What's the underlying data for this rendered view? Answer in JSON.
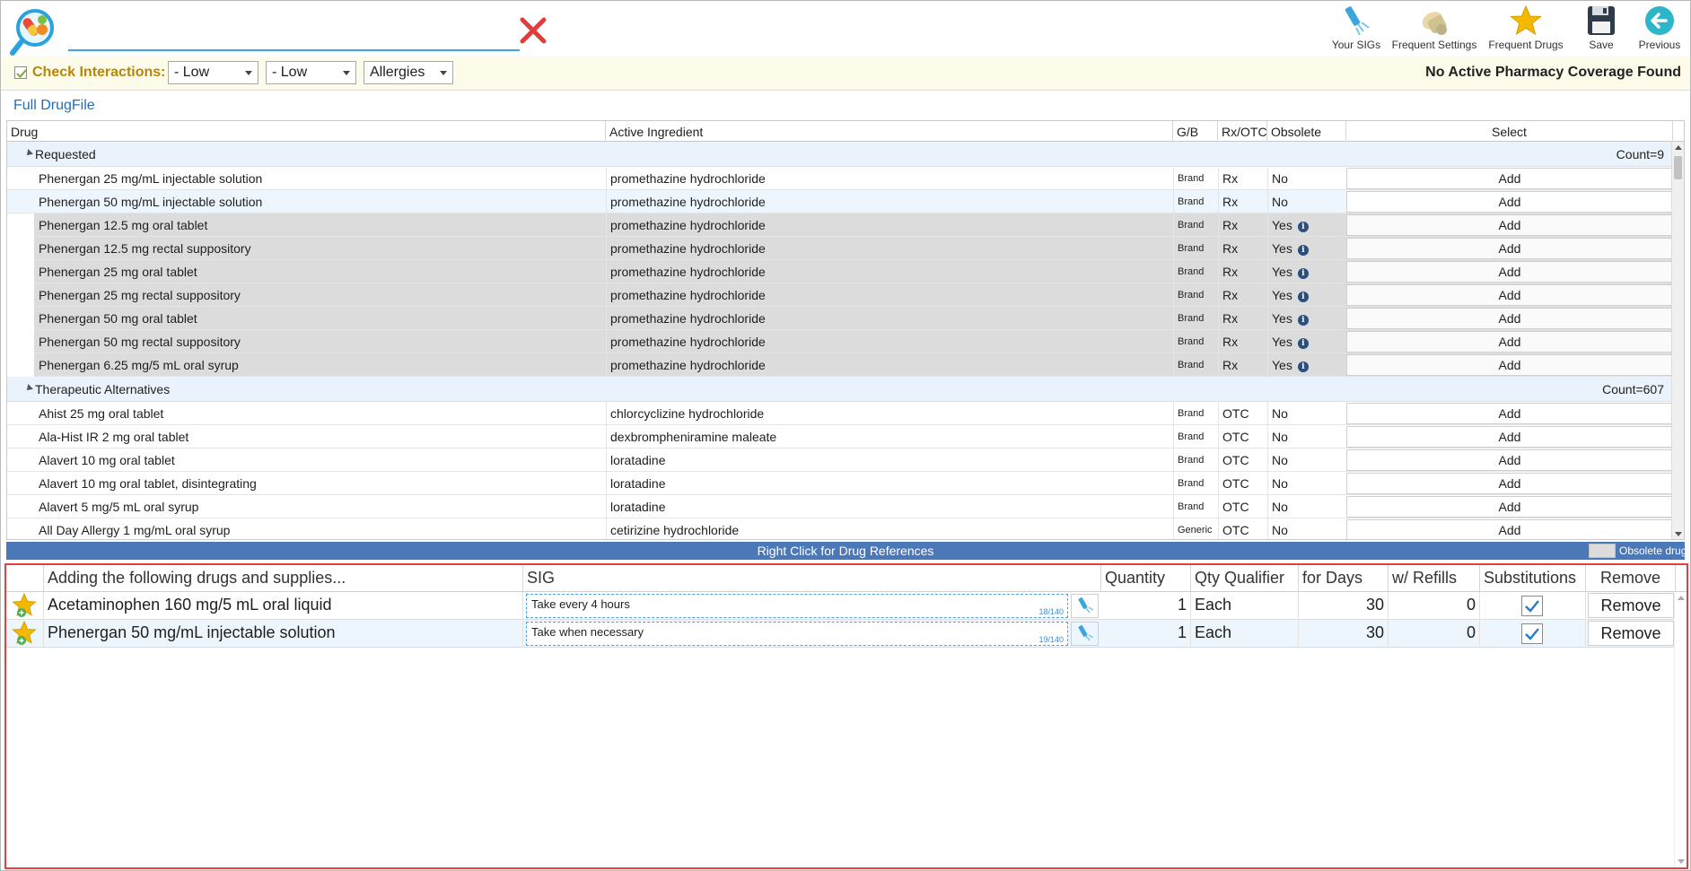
{
  "search": {
    "value": "",
    "placeholder": ""
  },
  "toolbar": {
    "your_sigs": "Your SIGs",
    "frequent_settings": "Frequent Settings",
    "frequent_drugs": "Frequent Drugs",
    "save": "Save",
    "previous": "Previous"
  },
  "interactions": {
    "label": "Check Interactions:",
    "checked": true,
    "select1": "- Low",
    "select2": "- Low",
    "select3": "Allergies",
    "coverage": "No Active Pharmacy Coverage Found"
  },
  "drugfile": {
    "link": "Full DrugFile",
    "columns": [
      "Drug",
      "Active Ingredient",
      "G/B",
      "Rx/OTC",
      "Obsolete",
      "Select"
    ],
    "groups": [
      {
        "name": "Requested",
        "count": "Count=9",
        "rows": [
          {
            "drug": "Phenergan 25 mg/mL injectable solution",
            "ingredient": "promethazine hydrochloride",
            "gb": "Brand",
            "rx": "Rx",
            "obsolete": "No",
            "select": "Add"
          },
          {
            "drug": "Phenergan 50 mg/mL injectable solution",
            "ingredient": "promethazine hydrochloride",
            "gb": "Brand",
            "rx": "Rx",
            "obsolete": "No",
            "select": "Add"
          },
          {
            "drug": "Phenergan 12.5 mg oral tablet",
            "ingredient": "promethazine hydrochloride",
            "gb": "Brand",
            "rx": "Rx",
            "obsolete": "Yes",
            "select": "Add"
          },
          {
            "drug": "Phenergan 12.5 mg rectal suppository",
            "ingredient": "promethazine hydrochloride",
            "gb": "Brand",
            "rx": "Rx",
            "obsolete": "Yes",
            "select": "Add"
          },
          {
            "drug": "Phenergan 25 mg oral tablet",
            "ingredient": "promethazine hydrochloride",
            "gb": "Brand",
            "rx": "Rx",
            "obsolete": "Yes",
            "select": "Add"
          },
          {
            "drug": "Phenergan 25 mg rectal suppository",
            "ingredient": "promethazine hydrochloride",
            "gb": "Brand",
            "rx": "Rx",
            "obsolete": "Yes",
            "select": "Add"
          },
          {
            "drug": "Phenergan 50 mg oral tablet",
            "ingredient": "promethazine hydrochloride",
            "gb": "Brand",
            "rx": "Rx",
            "obsolete": "Yes",
            "select": "Add"
          },
          {
            "drug": "Phenergan 50 mg rectal suppository",
            "ingredient": "promethazine hydrochloride",
            "gb": "Brand",
            "rx": "Rx",
            "obsolete": "Yes",
            "select": "Add"
          },
          {
            "drug": "Phenergan 6.25 mg/5 mL oral syrup",
            "ingredient": "promethazine hydrochloride",
            "gb": "Brand",
            "rx": "Rx",
            "obsolete": "Yes",
            "select": "Add"
          }
        ]
      },
      {
        "name": "Therapeutic Alternatives",
        "count": "Count=607",
        "rows": [
          {
            "drug": "Ahist 25 mg oral tablet",
            "ingredient": "chlorcyclizine hydrochloride",
            "gb": "Brand",
            "rx": "OTC",
            "obsolete": "No",
            "select": "Add"
          },
          {
            "drug": "Ala-Hist IR 2 mg oral tablet",
            "ingredient": "dexbrompheniramine maleate",
            "gb": "Brand",
            "rx": "OTC",
            "obsolete": "No",
            "select": "Add"
          },
          {
            "drug": "Alavert 10 mg oral tablet",
            "ingredient": "loratadine",
            "gb": "Brand",
            "rx": "OTC",
            "obsolete": "No",
            "select": "Add"
          },
          {
            "drug": "Alavert 10 mg oral tablet, disintegrating",
            "ingredient": "loratadine",
            "gb": "Brand",
            "rx": "OTC",
            "obsolete": "No",
            "select": "Add"
          },
          {
            "drug": "Alavert 5 mg/5 mL oral syrup",
            "ingredient": "loratadine",
            "gb": "Brand",
            "rx": "OTC",
            "obsolete": "No",
            "select": "Add"
          },
          {
            "drug": "All Day Allergy 1 mg/mL oral syrup",
            "ingredient": "cetirizine hydrochloride",
            "gb": "Generic",
            "rx": "OTC",
            "obsolete": "No",
            "select": "Add"
          }
        ]
      }
    ],
    "ref_bar": "Right Click for Drug References",
    "obsolete_legend": "Obsolete drug"
  },
  "adding": {
    "columns": [
      "Adding the following drugs and supplies...",
      "SIG",
      "Quantity",
      "Qty Qualifier",
      "for Days",
      "w/ Refills",
      "Substitutions",
      "Remove"
    ],
    "rows": [
      {
        "drug": "Acetaminophen 160 mg/5 mL oral liquid",
        "sig": "Take every 4 hours",
        "sig_count": "18/140",
        "quantity": "1",
        "qualifier": "Each",
        "days": "30",
        "refills": "0",
        "substitutions": true,
        "remove": "Remove"
      },
      {
        "drug": "Phenergan 50 mg/mL injectable solution",
        "sig": "Take when necessary",
        "sig_count": "19/140",
        "quantity": "1",
        "qualifier": "Each",
        "days": "30",
        "refills": "0",
        "substitutions": true,
        "remove": "Remove"
      }
    ]
  },
  "colors": {
    "accent": "#3aa6dd",
    "ref_bar": "#4c78b8",
    "obsolete_row": "#dcdcdc",
    "highlight_border": "#e04040",
    "interact_label": "#b8860b"
  }
}
